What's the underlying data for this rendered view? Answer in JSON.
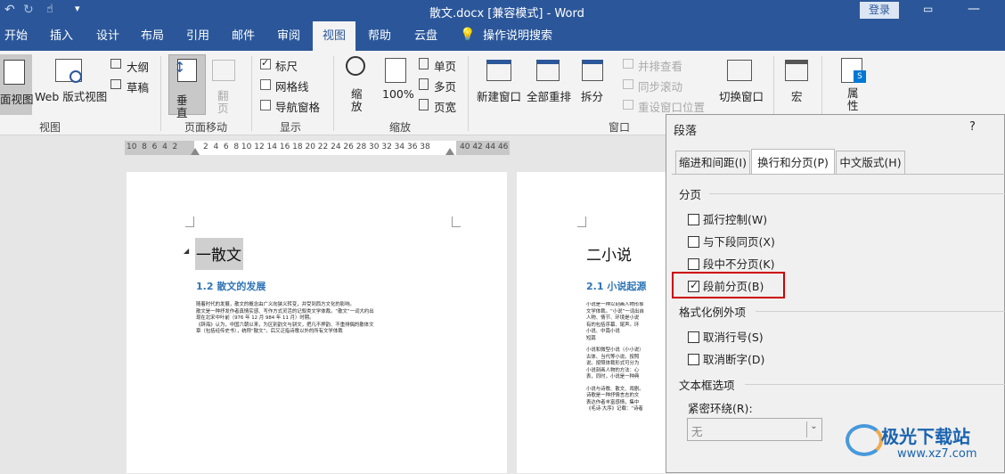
{
  "titlebar": {
    "doc_title": "散文.docx [兼容模式]  -  Word",
    "login": "登录"
  },
  "tabs": [
    "开始",
    "插入",
    "设计",
    "布局",
    "引用",
    "邮件",
    "审阅",
    "视图",
    "帮助",
    "云盘",
    "操作说明搜索"
  ],
  "ribbon": {
    "views": {
      "read": "面视图",
      "web": "Web 版式视图",
      "outline": "大纲",
      "draft": "草稿",
      "label": "视图"
    },
    "page_move": {
      "vertical": "垂直",
      "flip": "翻页",
      "label": "页面移动"
    },
    "show": {
      "ruler": "标尺",
      "gridlines": "网格线",
      "nav_pane": "导航窗格",
      "label": "显示",
      "ruler_checked": true,
      "grid_checked": false,
      "nav_checked": false
    },
    "zoom": {
      "zoom": "缩放",
      "percent": "100%",
      "one_page": "单页",
      "multi_page": "多页",
      "page_width": "页宽",
      "label": "缩放"
    },
    "window": {
      "new_window": "新建窗口",
      "arrange_all": "全部重排",
      "split": "拆分",
      "side_by_side": "并排查看",
      "sync_scroll": "同步滚动",
      "reset_pos": "重设窗口位置",
      "switch_window": "切换窗口",
      "label": "窗口"
    },
    "macros": {
      "label": "宏"
    },
    "properties": {
      "label": "属性"
    }
  },
  "ruler": {
    "left_ticks": "10  8  6  4  2",
    "mid_ticks": "2  4  6  8 10 12 14 16 18 20 22 24 26 28 30 32 34 36 38",
    "right_ticks": "40 42 44 46"
  },
  "doc": {
    "page1": {
      "h1": "一散文",
      "h2": "1.2 散文的发展",
      "body": [
        "随着时代的发展，散文的概念由广义向狭义转变，并受到西方文化的影响。",
        "散文是一种抒发作者真情实感、写作方式灵活的记叙类文学体裁。“散文”一词大约出",
        "现在北宋中叶前（976 年 12 月 984 年 11 月）时期。",
        "《辞海》认为，中国六朝以来，为区别韵文与骈文，把凡不押韵、不重排偶的散体文",
        "章（包括经传史书），统称“散文”。后又泛指诗歌以外的所有文学体裁"
      ]
    },
    "page2": {
      "h1": "二小说",
      "h2": "2.1 小说起源",
      "body": [
        "小说是一种以刻画人物形象",
        "文学体裁。“小说”一词出自",
        "人物、情节、环境是小说",
        "有的包括序幕、尾声。环",
        "小说、中篇小说",
        "短篇",
        "小说和微型小说（小小说）",
        "古体、当代等小说。按照",
        "说。按照体裁形式可分为",
        "小说刻画人物的方法：心",
        "表，同时，小说是一种典",
        "小说与诗歌、散文、戏剧。",
        "诗歌是一种抒情言志的文",
        "表达作者丰富感情，集中",
        "《毛诗·大序》记载：“诗者"
      ]
    }
  },
  "dialog": {
    "title": "段落",
    "help": "?",
    "tabs": [
      "缩进和间距(I)",
      "换行和分页(P)",
      "中文版式(H)"
    ],
    "pagination": {
      "label": "分页",
      "options": [
        {
          "label": "孤行控制(W)",
          "checked": false
        },
        {
          "label": "与下段同页(X)",
          "checked": false
        },
        {
          "label": "段中不分页(K)",
          "checked": false
        },
        {
          "label": "段前分页(B)",
          "checked": true
        }
      ]
    },
    "format_exceptions": {
      "label": "格式化例外项",
      "options": [
        {
          "label": "取消行号(S)",
          "checked": false
        },
        {
          "label": "取消断字(D)",
          "checked": false
        }
      ]
    },
    "textbox": {
      "label": "文本框选项",
      "wrap_label": "紧密环绕(R):",
      "wrap_value": "无"
    }
  },
  "watermark": {
    "brand": "极光下载站",
    "url": "www.xz7.com"
  },
  "colors": {
    "accent": "#2b579a",
    "highlight": "#cc0000"
  }
}
